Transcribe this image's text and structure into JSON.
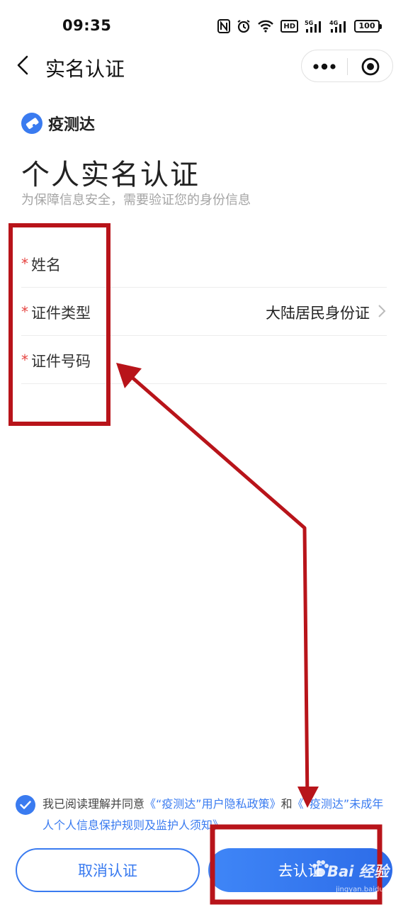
{
  "status_bar": {
    "time": "09:35",
    "icons": [
      "nfc-icon",
      "alarm-icon",
      "wifi-icon",
      "hd-icon",
      "signal-5g-icon",
      "signal-4g-icon",
      "battery-icon"
    ],
    "hd_label": "HD",
    "net1_label": "5G",
    "net2_label": "4G",
    "battery_level": "100"
  },
  "nav": {
    "title": "实名认证",
    "back_icon": "chevron-left-icon",
    "more_icon": "more-dots-icon",
    "close_icon": "target-circle-icon"
  },
  "brand": {
    "name": "疫测达",
    "logo_color": "#3a7bf0"
  },
  "page": {
    "title": "个人实名认证",
    "subtitle": "为保障信息安全，需要验证您的身份信息"
  },
  "form": {
    "required_mark": "*",
    "name_label": "姓名",
    "name_value": "",
    "id_type_label": "证件类型",
    "id_type_value": "大陆居民身份证",
    "id_number_label": "证件号码",
    "id_number_value": ""
  },
  "agreement": {
    "checked": true,
    "prefix": "我已阅读理解并同意",
    "link1": "《“疫测达”用户隐私政策》",
    "connector": "和",
    "link2": "《“疫测达”未成年人个人信息保护规则及监护人须知》"
  },
  "buttons": {
    "cancel_label": "取消认证",
    "submit_label": "去认证"
  },
  "watermark": {
    "main": "Bai 经验",
    "sub": "jingyan.baidu.com"
  },
  "colors": {
    "accent": "#3a7bf0",
    "required": "#e64340",
    "annotation": "#b8141a"
  }
}
